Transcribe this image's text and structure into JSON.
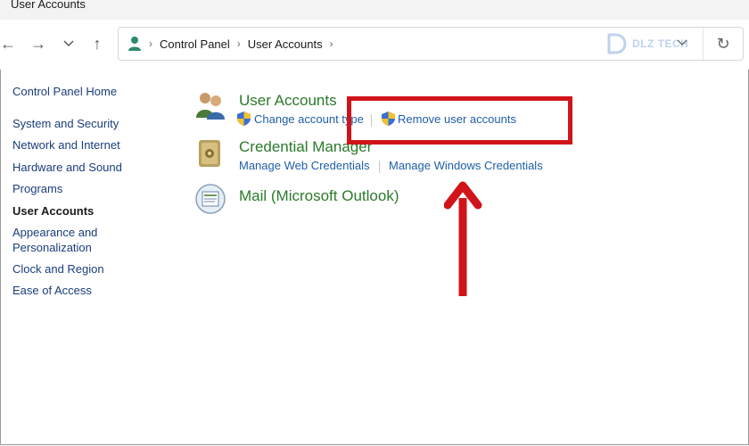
{
  "window": {
    "title": "User Accounts"
  },
  "nav": {
    "back": "←",
    "forward": "→",
    "recent": "⌄",
    "up": "↑",
    "breadcrumb": [
      "Control Panel",
      "User Accounts"
    ],
    "refresh": "↻"
  },
  "watermark": {
    "text": "DLZ TECH"
  },
  "sidebar": {
    "items": [
      {
        "label": "Control Panel Home"
      },
      {
        "label": "System and Security"
      },
      {
        "label": "Network and Internet"
      },
      {
        "label": "Hardware and Sound"
      },
      {
        "label": "Programs"
      },
      {
        "label": "User Accounts",
        "active": true
      },
      {
        "label": "Appearance and\nPersonalization"
      },
      {
        "label": "Clock and Region"
      },
      {
        "label": "Ease of Access"
      }
    ]
  },
  "main": {
    "user_accounts": {
      "title": "User Accounts",
      "links": [
        "Change account type",
        "Remove user accounts"
      ]
    },
    "credential_manager": {
      "title": "Credential Manager",
      "links": [
        "Manage Web Credentials",
        "Manage Windows Credentials"
      ]
    },
    "mail": {
      "title": "Mail (Microsoft Outlook)"
    }
  },
  "annotation": {
    "highlight_color": "#d01419"
  },
  "colors": {
    "title_green": "#2a7a2a",
    "link_blue": "#1f5fa6"
  }
}
